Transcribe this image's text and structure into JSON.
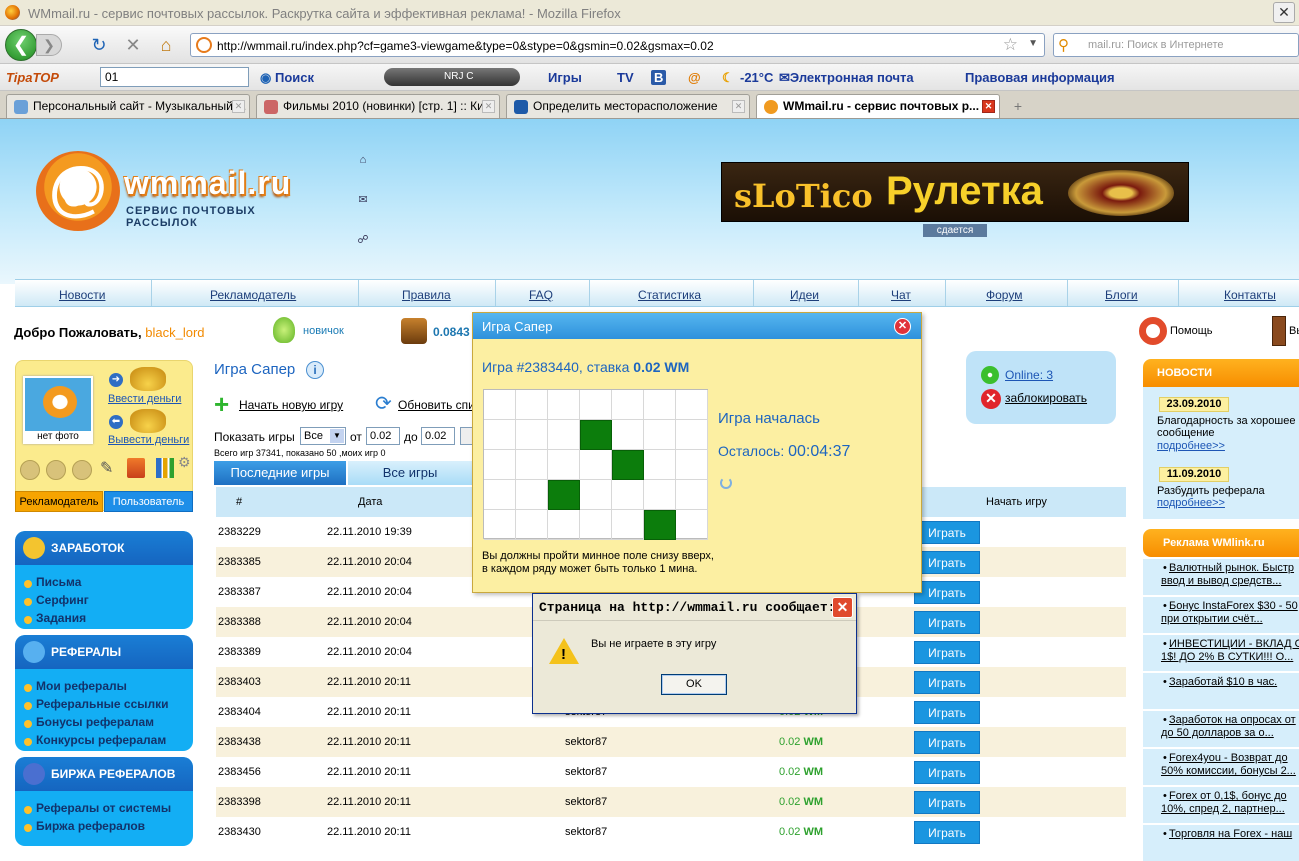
{
  "window": {
    "title": "WMmail.ru - сервис почтовых рассылок. Раскрутка сайта и эффективная реклама! - Mozilla Firefox"
  },
  "browser": {
    "url": "http://wmmail.ru/index.php?cf=game3-viewgame&type=0&stype=0&gsmin=0.02&gsmax=0.02",
    "search_placeholder": "mail.ru: Поиск в Интернете",
    "toolbar": {
      "logo": "TipaTOP",
      "select_value": "01",
      "search": "Поиск",
      "radio": "NRJ C",
      "games": "Игры",
      "tv": "TV",
      "weather": "-21°C",
      "email": "Электронная почта",
      "legal": "Правовая информация"
    },
    "tabs": [
      {
        "label": "Персональный сайт - Музыкальный ..."
      },
      {
        "label": "Фильмы 2010 (новинки) [стр. 1] :: Ки..."
      },
      {
        "label": "Определить месторасположение"
      },
      {
        "label": "WMmail.ru - сервис почтовых р..."
      }
    ]
  },
  "header": {
    "logo_name": "wmmail.ru",
    "logo_sub": "СЕРВИС ПОЧТОВЫХ РАССЫЛОК",
    "banner_brand": "sLoTico",
    "banner_title": "Рулетка",
    "banner_rent": "сдается"
  },
  "menu": [
    "Новости",
    "Рекламодатель",
    "Правила",
    "FAQ",
    "Статистика",
    "Идеи",
    "Чат",
    "Форум",
    "Блоги",
    "Контакты"
  ],
  "userbar": {
    "welcome": "Добро Пожаловать,",
    "username": "black_lord",
    "level": "новичок",
    "balance": "0.0843",
    "help": "Помощь",
    "exit": "Вы"
  },
  "userbox": {
    "photo": "нет фото",
    "deposit": "Ввести деньги",
    "withdraw": "Вывести деньги",
    "role_adv": "Рекламодатель",
    "role_user": "Пользователь"
  },
  "left_menus": [
    {
      "title": "ЗАРАБОТОК",
      "items": [
        "Письма",
        "Серфинг",
        "Задания"
      ]
    },
    {
      "title": "РЕФЕРАЛЫ",
      "items": [
        "Мои рефералы",
        "Реферальные ссылки",
        "Бонусы рефералам",
        "Конкурсы рефералам"
      ]
    },
    {
      "title": "БИРЖА РЕФЕРАЛОВ",
      "items": [
        "Рефералы от системы",
        "Биржа рефералов"
      ]
    }
  ],
  "game": {
    "title": "Игра Сапер",
    "new_game": "Начать новую игру",
    "refresh": "Обновить спи",
    "filter_label": "Показать игры",
    "filter_select": "Все",
    "from": "от",
    "to": "до",
    "min": "0.02",
    "max": "0.02",
    "stats": "Всего игр 37341, показано 50 ,моих игр 0",
    "tab_recent": "Последние игры",
    "tab_all": "Все игры",
    "col_num": "#",
    "col_date": "Дата",
    "col_start": "Начать игру",
    "play_label": "Играть",
    "currency": "WM",
    "rows": [
      {
        "id": "2383229",
        "date": "22.11.2010 19:39",
        "user": "",
        "amount": ""
      },
      {
        "id": "2383385",
        "date": "22.11.2010 20:04",
        "user": "",
        "amount": ""
      },
      {
        "id": "2383387",
        "date": "22.11.2010 20:04",
        "user": "",
        "amount": ""
      },
      {
        "id": "2383388",
        "date": "22.11.2010 20:04",
        "user": "",
        "amount": ""
      },
      {
        "id": "2383389",
        "date": "22.11.2010 20:04",
        "user": "",
        "amount": ""
      },
      {
        "id": "2383403",
        "date": "22.11.2010 20:11",
        "user": "",
        "amount": ""
      },
      {
        "id": "2383404",
        "date": "22.11.2010 20:11",
        "user": "sektor87",
        "amount": "0.02"
      },
      {
        "id": "2383438",
        "date": "22.11.2010 20:11",
        "user": "sektor87",
        "amount": "0.02"
      },
      {
        "id": "2383456",
        "date": "22.11.2010 20:11",
        "user": "sektor87",
        "amount": "0.02"
      },
      {
        "id": "2383398",
        "date": "22.11.2010 20:11",
        "user": "sektor87",
        "amount": "0.02"
      },
      {
        "id": "2383430",
        "date": "22.11.2010 20:11",
        "user": "sektor87",
        "amount": "0.02"
      }
    ]
  },
  "online": {
    "label": "Online: 3",
    "block": "заблокировать"
  },
  "news": {
    "title": "НОВОСТИ",
    "items": [
      {
        "date": "23.09.2010",
        "text": "Благодарность за хорошее сообщение",
        "more": "подробнее>>"
      },
      {
        "date": "11.09.2010",
        "text": "Разбудить реферала",
        "more": "подробнее>>"
      }
    ]
  },
  "ads": {
    "title": "Реклама WMlink.ru",
    "items": [
      [
        "Валютный рынок. Быстр",
        "ввод и вывод средств..."
      ],
      [
        "Бонус InstaForex $30 - 50",
        "при открытии счёт..."
      ],
      [
        "ИНВЕСТИЦИИ - ВКЛАД О",
        "1$! ДО 2% В СУТКИ!!! О..."
      ],
      [
        "Заработай $10 в час.",
        ""
      ],
      [
        "Заработок на опросах от",
        "до 50 долларов за о..."
      ],
      [
        "Forex4you - Возврат до",
        "50% комиссии, бонусы 2..."
      ],
      [
        "Forex от 0,1$, бонус до",
        "10%, спред 2, партнер..."
      ],
      [
        "Торговля на Forex - наш",
        ""
      ]
    ]
  },
  "game_dialog": {
    "title": "Игра Сапер",
    "game_line": "Игра #2383440, ставка",
    "stake": "0.02 WM",
    "status": "Игра началась",
    "remaining_label": "Осталось:",
    "remaining": "00:04:37",
    "rule1": "Вы должны пройти минное поле снизу вверх,",
    "rule2": "в каждом ряду может быть только 1 мина.",
    "mines": [
      {
        "row": 1,
        "col": 3
      },
      {
        "row": 2,
        "col": 4
      },
      {
        "row": 3,
        "col": 2
      },
      {
        "row": 4,
        "col": 5
      }
    ]
  },
  "alert": {
    "title": "Страница на http://wmmail.ru сообщает:",
    "message": "Вы не играете в эту игру",
    "ok": "OK"
  }
}
